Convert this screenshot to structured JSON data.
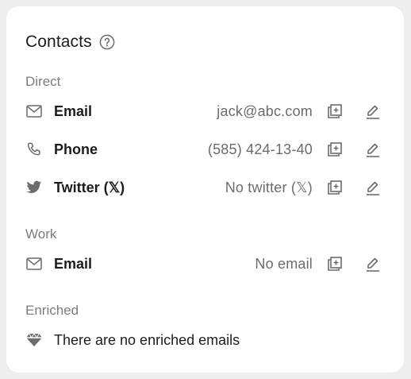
{
  "title": "Contacts",
  "sections": {
    "direct": {
      "label": "Direct",
      "rows": [
        {
          "label": "Email",
          "value": "jack@abc.com",
          "icon": "mail-icon"
        },
        {
          "label": "Phone",
          "value": "(585) 424-13-40",
          "icon": "phone-icon"
        },
        {
          "label": "Twitter (𝕏)",
          "value": "No twitter (𝕏)",
          "icon": "twitter-icon"
        }
      ]
    },
    "work": {
      "label": "Work",
      "rows": [
        {
          "label": "Email",
          "value": "No email",
          "icon": "mail-icon"
        }
      ]
    },
    "enriched": {
      "label": "Enriched",
      "message": "There are no enriched emails",
      "icon": "gem-icon"
    }
  },
  "colors": {
    "icon": "#6b6b70",
    "muted": "#7b7b80",
    "card": "#ffffff",
    "background": "#eeeef0"
  }
}
